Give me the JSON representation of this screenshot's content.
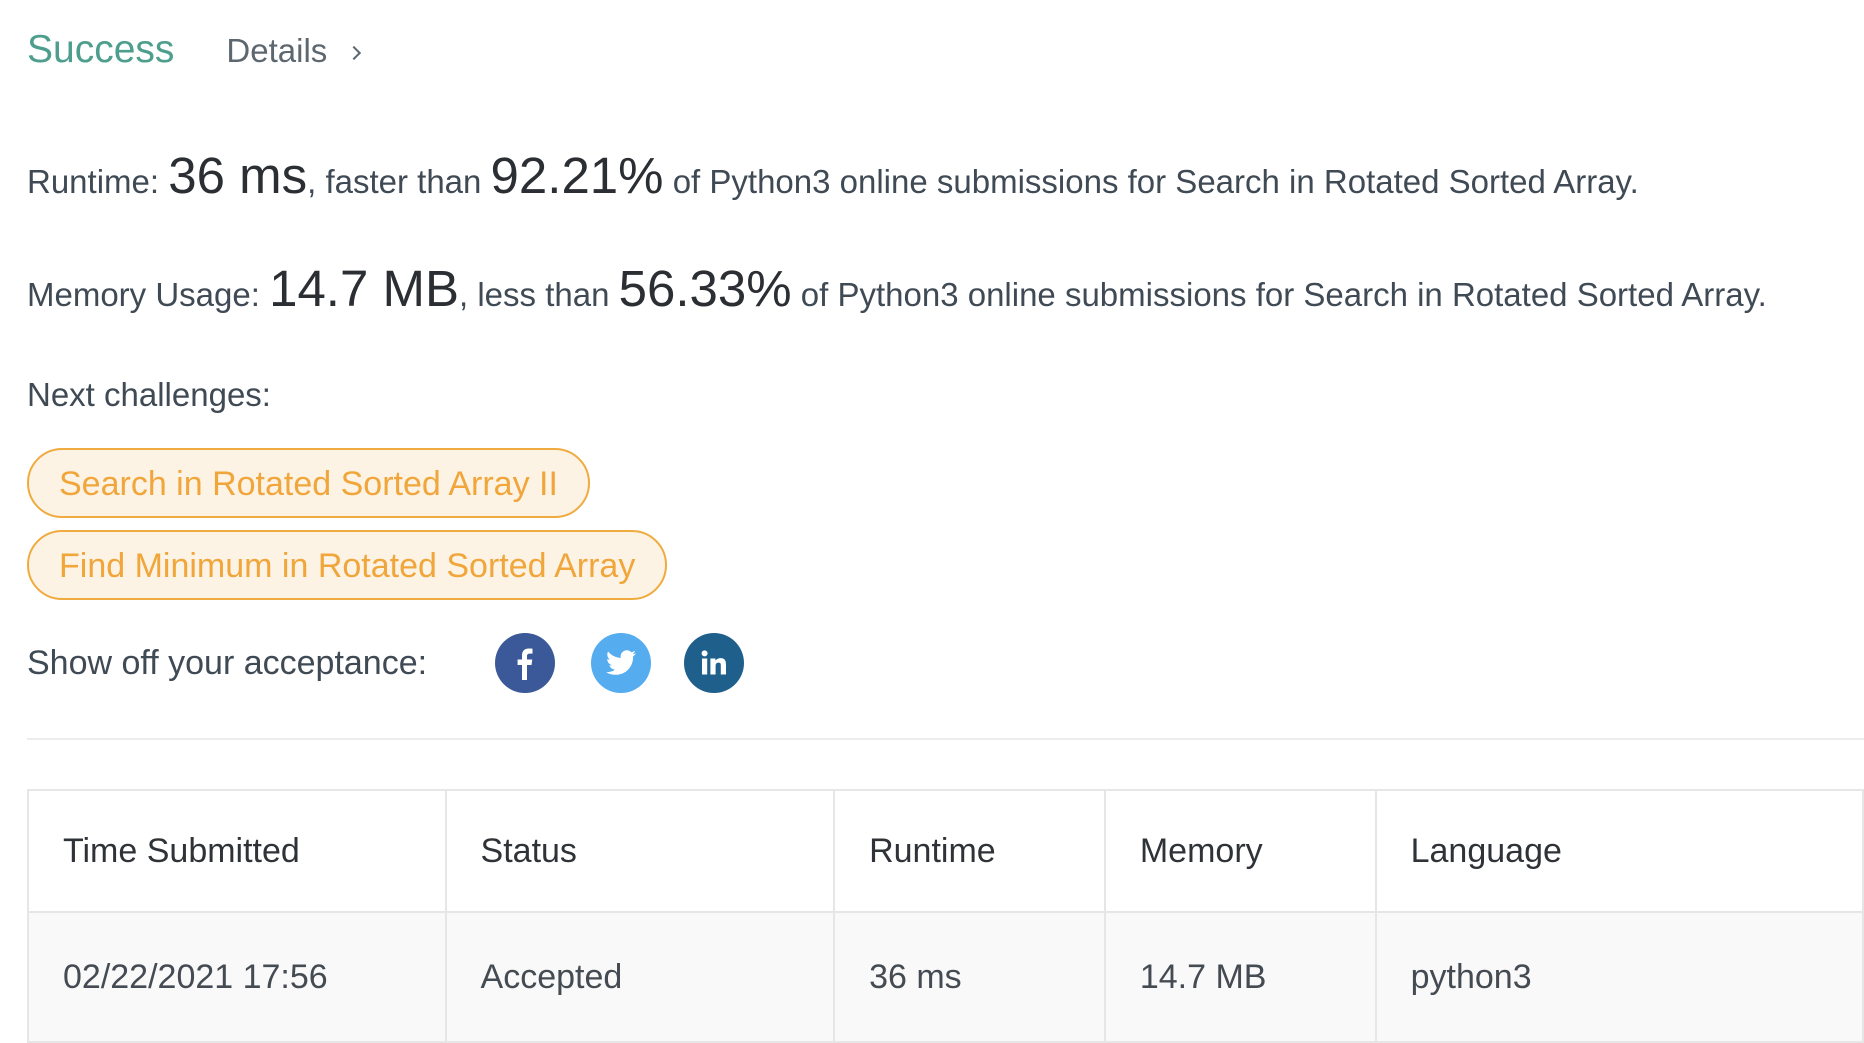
{
  "header": {
    "status": "Success",
    "details_label": "Details"
  },
  "runtime": {
    "label": "Runtime: ",
    "value": "36 ms",
    "comparison": ", faster than ",
    "percent": "92.21%",
    "suffix": " of Python3 online submissions for Search in Rotated Sorted Array."
  },
  "memory": {
    "label": "Memory Usage: ",
    "value": "14.7 MB",
    "comparison": ", less than ",
    "percent": "56.33%",
    "suffix": " of Python3 online submissions for Search in Rotated Sorted Array."
  },
  "next_challenges": {
    "label": "Next challenges:",
    "items": [
      "Search in Rotated Sorted Array II",
      "Find Minimum in Rotated Sorted Array"
    ]
  },
  "share": {
    "label": "Show off your acceptance:",
    "icons": [
      "facebook-icon",
      "twitter-icon",
      "linkedin-icon"
    ]
  },
  "colors": {
    "success": "#4e9e8e",
    "challenge_pill": "#f0a63b",
    "facebook": "#3b5998",
    "twitter": "#55acee",
    "linkedin": "#1f5f8b"
  },
  "table": {
    "columns": [
      "Time Submitted",
      "Status",
      "Runtime",
      "Memory",
      "Language"
    ],
    "rows": [
      [
        "02/22/2021 17:56",
        "Accepted",
        "36 ms",
        "14.7 MB",
        "python3"
      ]
    ]
  }
}
